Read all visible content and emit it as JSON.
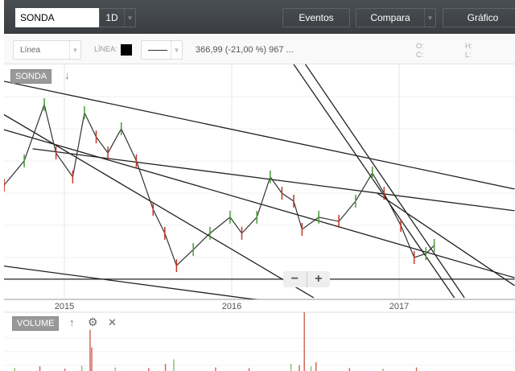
{
  "topbar": {
    "symbol": "SONDA",
    "interval": "1D",
    "eventos": "Eventos",
    "compara": "Compara",
    "grafico": "Gráfico"
  },
  "toolbar": {
    "chart_type": "Línea",
    "line_label": "LÍNEA:",
    "line_color": "#000000",
    "quote": "366,99 (-21,00 %) 967 ...",
    "o": "O:",
    "c": "C:",
    "h": "H:",
    "l": "L:"
  },
  "panels": {
    "price_label": "SONDA",
    "volume_label": "VOLUME",
    "zoom_out": "−",
    "zoom_in": "+"
  },
  "chart_data": {
    "type": "line",
    "title": "SONDA",
    "xlabel": "",
    "ylabel": "",
    "xticks": [
      "2015",
      "2016",
      "2017"
    ],
    "xlim": [
      2014.62,
      2017.67
    ],
    "ylim": [
      700,
      1500
    ],
    "x": [
      2014.64,
      2014.76,
      2014.88,
      2014.95,
      2015.05,
      2015.12,
      2015.19,
      2015.26,
      2015.34,
      2015.43,
      2015.53,
      2015.6,
      2015.67,
      2015.77,
      2015.87,
      2015.99,
      2016.06,
      2016.15,
      2016.23,
      2016.3,
      2016.37,
      2016.42,
      2016.52,
      2016.64,
      2016.74,
      2016.84,
      2016.91,
      2017.01,
      2017.09,
      2017.16,
      2017.21
    ],
    "values": [
      1100,
      1186,
      1386,
      1214,
      1129,
      1357,
      1271,
      1214,
      1300,
      1186,
      1014,
      929,
      814,
      871,
      929,
      986,
      929,
      986,
      1129,
      1071,
      1043,
      943,
      986,
      971,
      1043,
      1143,
      1071,
      957,
      843,
      857,
      886
    ],
    "trendlines": [
      [
        [
          2014.62,
          1471
        ],
        [
          2017.69,
          1086
        ]
      ],
      [
        [
          2014.62,
          1357
        ],
        [
          2016.49,
          700
        ]
      ],
      [
        [
          2014.62,
          1300
        ],
        [
          2017.69,
          771
        ]
      ],
      [
        [
          2014.81,
          1229
        ],
        [
          2017.69,
          1009
        ]
      ],
      [
        [
          2014.62,
          814
        ],
        [
          2016.49,
          666
        ]
      ],
      [
        [
          2014.62,
          766
        ],
        [
          2017.69,
          766
        ]
      ],
      [
        [
          2016.37,
          1529
        ],
        [
          2017.33,
          700
        ]
      ],
      [
        [
          2016.44,
          1529
        ],
        [
          2017.39,
          700
        ]
      ],
      [
        [
          2016.87,
          1071
        ],
        [
          2017.69,
          743
        ]
      ]
    ],
    "volume": {
      "x": [
        2014.7,
        2014.85,
        2015.0,
        2015.1,
        2015.15,
        2015.16,
        2015.3,
        2015.5,
        2015.6,
        2015.65,
        2015.9,
        2016.1,
        2016.35,
        2016.4,
        2016.43,
        2016.47,
        2016.5,
        2016.7,
        2016.9,
        2017.1
      ],
      "values": [
        5,
        8,
        4,
        9,
        70,
        40,
        6,
        5,
        12,
        20,
        6,
        5,
        12,
        10,
        100,
        8,
        15,
        5,
        4,
        6
      ]
    }
  }
}
